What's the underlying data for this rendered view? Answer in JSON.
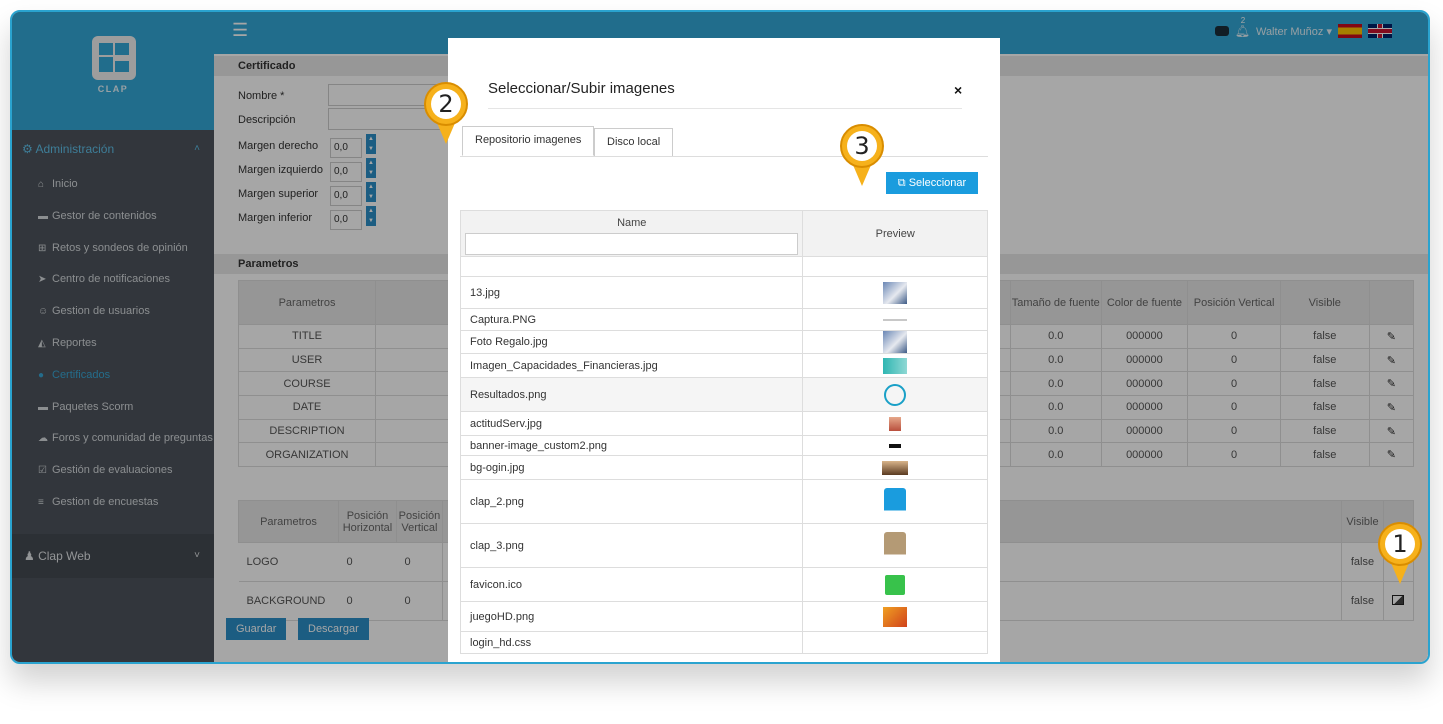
{
  "sidebar": {
    "logo_text": "CLAP",
    "section_admin": "Administración",
    "items": [
      {
        "label": "Inicio",
        "icon": "home-icon"
      },
      {
        "label": "Gestor de contenidos",
        "icon": "book-icon"
      },
      {
        "label": "Retos y sondeos de opinión",
        "icon": "sitemap-icon"
      },
      {
        "label": "Centro de notificaciones",
        "icon": "send-icon"
      },
      {
        "label": "Gestion de usuarios",
        "icon": "users-icon"
      },
      {
        "label": "Reportes",
        "icon": "area-chart-icon"
      },
      {
        "label": "Certificados",
        "icon": "circle-icon",
        "active": true
      },
      {
        "label": "Paquetes Scorm",
        "icon": "box-icon"
      },
      {
        "label": "Foros y comunidad de preguntas",
        "icon": "comments-icon"
      },
      {
        "label": "Gestión de evaluaciones",
        "icon": "check-square-icon"
      },
      {
        "label": "Gestion de encuestas",
        "icon": "list-icon"
      }
    ],
    "clap_web": "Clap Web"
  },
  "topbar": {
    "user": "Walter Muñoz",
    "notification_count": "2"
  },
  "form": {
    "section_title": "Certificado",
    "fields": [
      {
        "label": "Nombre *"
      },
      {
        "label": "Descripción"
      },
      {
        "label": "Margen derecho",
        "value": "0,0"
      },
      {
        "label": "Margen izquierdo",
        "value": "0,0"
      },
      {
        "label": "Margen superior",
        "value": "0,0"
      },
      {
        "label": "Margen inferior",
        "value": "0,0"
      }
    ]
  },
  "params": {
    "section_title": "Parametros",
    "table1": {
      "header_first": "Parametros",
      "headers_right": [
        "Tamaño de fuente",
        "Color de fuente",
        "Posición Vertical",
        "Visible"
      ],
      "rows": [
        {
          "name": "TITLE",
          "size": "0.0",
          "color": "000000",
          "pos": "0",
          "visible": "false"
        },
        {
          "name": "USER",
          "size": "0.0",
          "color": "000000",
          "pos": "0",
          "visible": "false"
        },
        {
          "name": "COURSE",
          "size": "0.0",
          "color": "000000",
          "pos": "0",
          "visible": "false"
        },
        {
          "name": "DATE",
          "size": "0.0",
          "color": "000000",
          "pos": "0",
          "visible": "false"
        },
        {
          "name": "DESCRIPTION",
          "size": "0.0",
          "color": "000000",
          "pos": "0",
          "visible": "false"
        },
        {
          "name": "ORGANIZATION",
          "size": "0.0",
          "color": "000000",
          "pos": "0",
          "visible": "false"
        }
      ]
    },
    "table2": {
      "headers": [
        "Parametros",
        "Posición Horizontal",
        "Posición Vertical",
        "Visible"
      ],
      "rows": [
        {
          "name": "LOGO",
          "h": "0",
          "v": "0",
          "visible": "false"
        },
        {
          "name": "BACKGROUND",
          "h": "0",
          "v": "0",
          "visible": "false"
        }
      ]
    }
  },
  "buttons": {
    "save": "Guardar",
    "download": "Descargar"
  },
  "modal": {
    "title": "Seleccionar/Subir imagenes",
    "close": "×",
    "tabs": [
      "Repositorio imagenes",
      "Disco local"
    ],
    "select_button": "Seleccionar",
    "col_name": "Name",
    "col_preview": "Preview",
    "files": [
      {
        "name": "13.jpg",
        "thumb": "photo"
      },
      {
        "name": "Captura.PNG",
        "thumb": "line"
      },
      {
        "name": "Foto Regalo.jpg",
        "thumb": "photo"
      },
      {
        "name": "Imagen_Capacidades_Financieras.jpg",
        "thumb": "teal"
      },
      {
        "name": "Resultados.png",
        "thumb": "gauge"
      },
      {
        "name": "actitudServ.jpg",
        "thumb": "small"
      },
      {
        "name": "banner-image_custom2.png",
        "thumb": "dots"
      },
      {
        "name": "bg-ogin.jpg",
        "thumb": "brown"
      },
      {
        "name": "clap_2.png",
        "thumb": "clap-blue"
      },
      {
        "name": "clap_3.png",
        "thumb": "clap-tan"
      },
      {
        "name": "favicon.ico",
        "thumb": "clap-green"
      },
      {
        "name": "juegoHD.png",
        "thumb": "orange"
      },
      {
        "name": "login_hd.css",
        "thumb": "none"
      }
    ]
  },
  "pins": [
    "1",
    "2",
    "3"
  ],
  "colors": {
    "accent": "#33a8d8",
    "sidebar": "#4d545c",
    "pin": "#f6b11b",
    "button": "#2b8fc8"
  }
}
